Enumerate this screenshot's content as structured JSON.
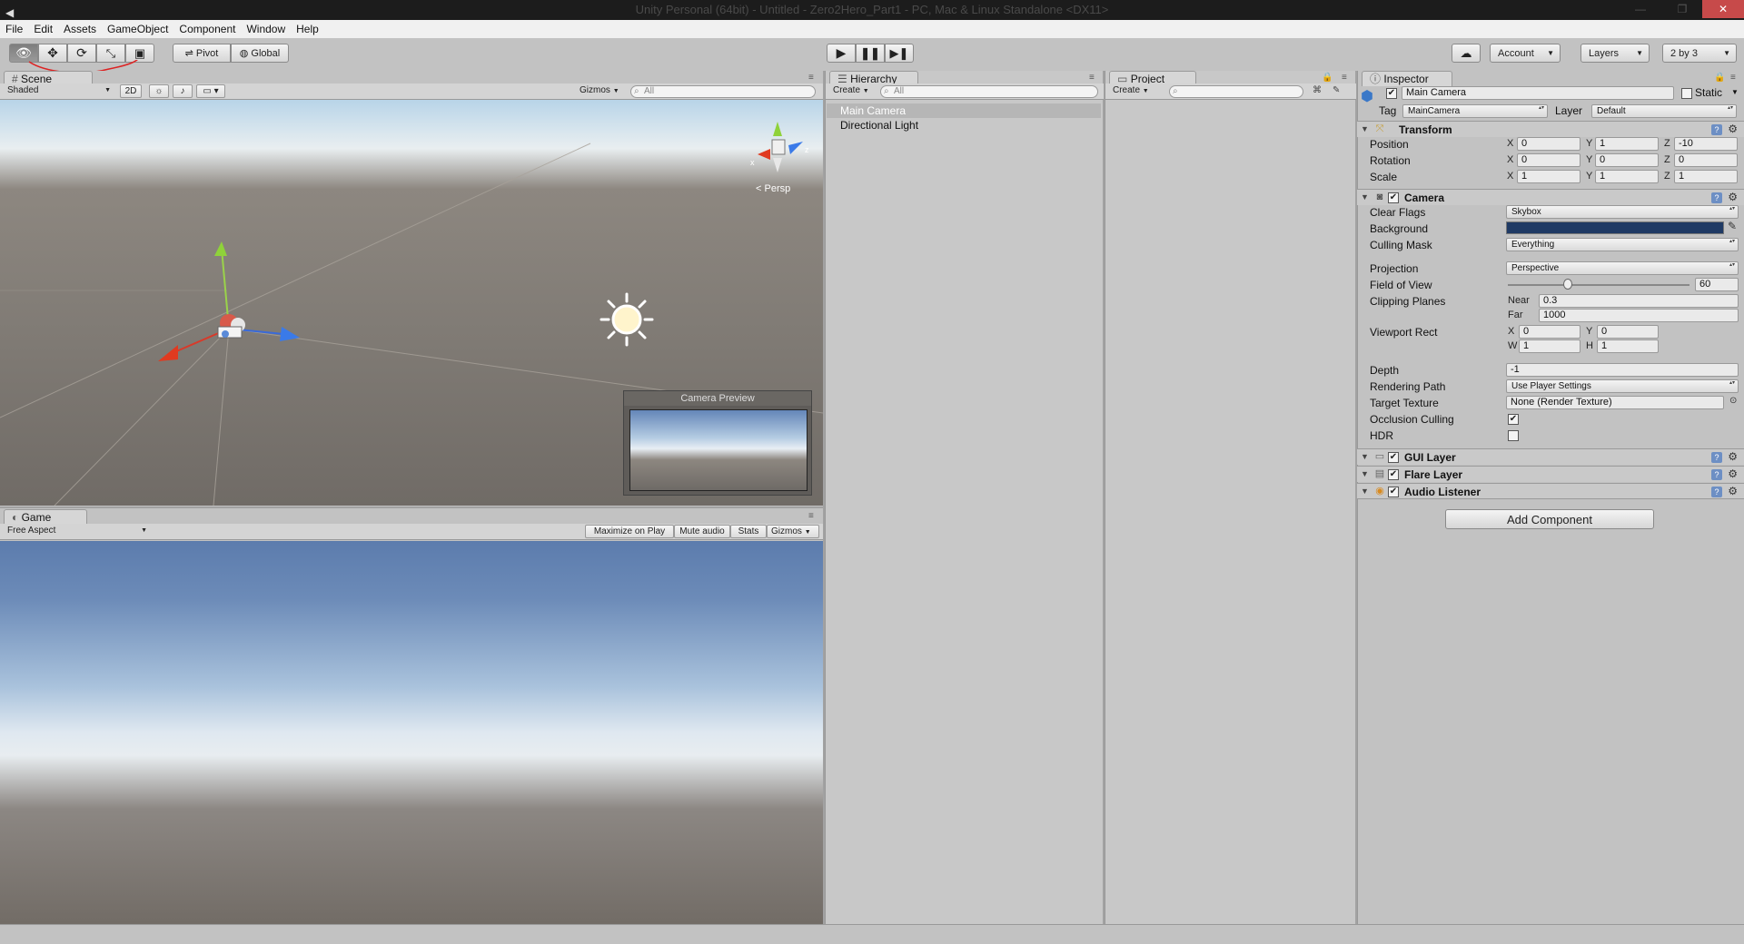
{
  "window": {
    "title": "Unity Personal (64bit) - Untitled - Zero2Hero_Part1 - PC, Mac & Linux Standalone <DX11>",
    "minimize": "—",
    "maximize": "❐",
    "close": "✕"
  },
  "menu": [
    "File",
    "Edit",
    "Assets",
    "GameObject",
    "Component",
    "Window",
    "Help"
  ],
  "toolbar": {
    "pivot_label": "Pivot",
    "global_label": "Global",
    "account_label": "Account",
    "layers_label": "Layers",
    "layout_label": "2 by 3"
  },
  "scene": {
    "tab_label": "Scene",
    "shading": "Shaded",
    "mode_2d": "2D",
    "gizmos_label": "Gizmos",
    "search_placeholder": "All",
    "persp_label": "Persp",
    "camera_preview_title": "Camera Preview"
  },
  "game": {
    "tab_label": "Game",
    "aspect": "Free Aspect",
    "maximize_on_play": "Maximize on Play",
    "mute_audio": "Mute audio",
    "stats": "Stats",
    "gizmos_label": "Gizmos"
  },
  "hierarchy": {
    "tab_label": "Hierarchy",
    "create_label": "Create",
    "search_placeholder": "All",
    "items": [
      "Main Camera",
      "Directional Light"
    ]
  },
  "project": {
    "tab_label": "Project",
    "create_label": "Create"
  },
  "inspector": {
    "tab_label": "Inspector",
    "object_name": "Main Camera",
    "static_label": "Static",
    "tag_label": "Tag",
    "tag_value": "MainCamera",
    "layer_label": "Layer",
    "layer_value": "Default",
    "transform": {
      "title": "Transform",
      "position_label": "Position",
      "rotation_label": "Rotation",
      "scale_label": "Scale",
      "position": {
        "x": "0",
        "y": "1",
        "z": "-10"
      },
      "rotation": {
        "x": "0",
        "y": "0",
        "z": "0"
      },
      "scale": {
        "x": "1",
        "y": "1",
        "z": "1"
      }
    },
    "camera": {
      "title": "Camera",
      "clear_flags_label": "Clear Flags",
      "clear_flags": "Skybox",
      "background_label": "Background",
      "background_color": "#1f3a64",
      "culling_mask_label": "Culling Mask",
      "culling_mask": "Everything",
      "projection_label": "Projection",
      "projection": "Perspective",
      "fov_label": "Field of View",
      "fov": "60",
      "fov_fraction": 0.33,
      "clipping_label": "Clipping Planes",
      "near_label": "Near",
      "near": "0.3",
      "far_label": "Far",
      "far": "1000",
      "viewport_label": "Viewport Rect",
      "viewport": {
        "x": "0",
        "y": "0",
        "w": "1",
        "h": "1"
      },
      "depth_label": "Depth",
      "depth": "-1",
      "rendering_path_label": "Rendering Path",
      "rendering_path": "Use Player Settings",
      "target_texture_label": "Target Texture",
      "target_texture": "None (Render Texture)",
      "occlusion_label": "Occlusion Culling",
      "hdr_label": "HDR"
    },
    "components": [
      "GUI Layer",
      "Flare Layer",
      "Audio Listener"
    ],
    "add_component": "Add Component"
  },
  "axis_letters": {
    "x": "X",
    "y": "Y",
    "z": "Z",
    "w": "W",
    "h": "H"
  }
}
